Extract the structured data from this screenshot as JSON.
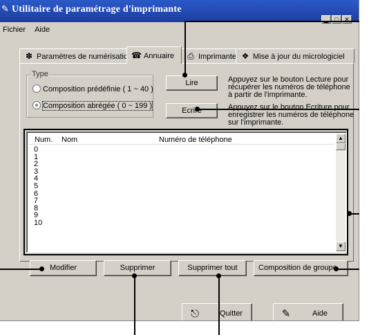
{
  "window": {
    "title": "Utilitaire de paramétrage d'imprimante",
    "icon": "printer-settings-icon",
    "controls": [
      "minimize-icon",
      "maximize-icon",
      "close-icon"
    ]
  },
  "menu": [
    "Fichier",
    "Aide"
  ],
  "tabs": [
    {
      "label": "Paramètres de numérisation",
      "icon": "scanner-icon",
      "active": false
    },
    {
      "label": "Annuaire",
      "icon": "phonebook-icon",
      "active": true
    },
    {
      "label": "Imprimante",
      "icon": "printer-icon",
      "active": false
    },
    {
      "label": "Mise à jour du micrologiciel",
      "icon": "firmware-icon",
      "active": false
    }
  ],
  "type_group": {
    "legend": "Type",
    "options": [
      {
        "label": "Composition prédéfinie ( 1 ~ 40 )",
        "selected": false
      },
      {
        "label": "Composition abrégée ( 0 ~ 199 )",
        "selected": true
      }
    ]
  },
  "buttons": {
    "read": "Lire",
    "write": "Ecrire",
    "modify": "Modifier",
    "delete": "Supprimer",
    "delete_all": "Supprimer tout",
    "group_dial": "Composition de groupe...",
    "quit": "Quitter",
    "help": "Aide"
  },
  "hints": {
    "read": "Appuyez sur le bouton Lecture pour récupérer les numéros de téléphone à partir de l'imprimante.",
    "write": "Appuyez sur le bouton Ecriture pour enregistrer les numéros de téléphone sur l'imprimante."
  },
  "list": {
    "columns": [
      "Num.",
      "Nom",
      "Numéro de téléphone"
    ],
    "rows": [
      "0",
      "1",
      "2",
      "3",
      "4",
      "5",
      "6",
      "7",
      "8",
      "9",
      "10"
    ]
  },
  "colors": {
    "titlebar": "#1d3e9f",
    "face": "#d4d0c8",
    "callout": "#000000"
  }
}
